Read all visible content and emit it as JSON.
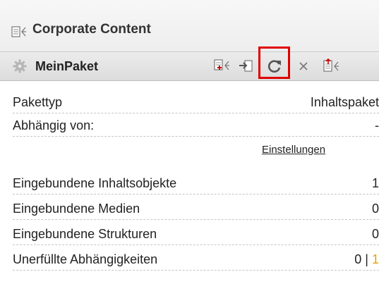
{
  "header": {
    "title": "Corporate Content",
    "title_icon": "content-list-icon"
  },
  "package_bar": {
    "name": "MeinPaket",
    "icons": [
      "gear-icon",
      "add-content-icon",
      "import-icon",
      "refresh-icon",
      "close-icon",
      "upload-content-icon"
    ],
    "highlight_color": "#e00000"
  },
  "details": {
    "paket_typ": {
      "label": "Pakettyp",
      "value": "Inhaltspaket"
    },
    "abhaengig": {
      "label": "Abhängig von:",
      "value": "-"
    },
    "settings_link": "Einstellungen",
    "inhaltsobjekte": {
      "label": "Eingebundene Inhaltsobjekte",
      "value": "1"
    },
    "medien": {
      "label": "Eingebundene Medien",
      "value": "0"
    },
    "strukturen": {
      "label": "Eingebundene Strukturen",
      "value": "0"
    },
    "unerfuellt": {
      "label": "Unerfüllte Abhängigkeiten",
      "value_a": "0",
      "separator": "|",
      "value_b": "1"
    }
  },
  "colors": {
    "accent_orange": "#e2a400",
    "highlight": "#e00000"
  }
}
